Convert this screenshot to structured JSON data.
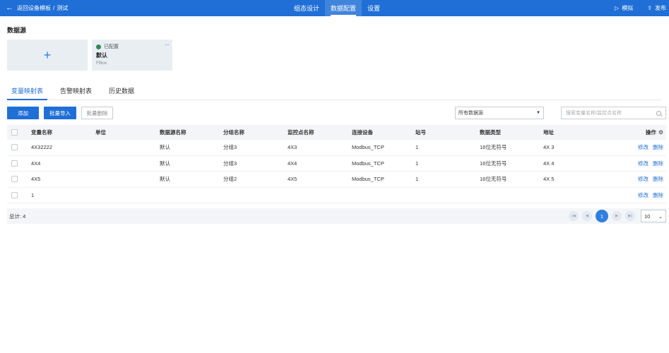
{
  "topbar": {
    "back_label": "返回设备模板",
    "separator": "/",
    "project": "测试",
    "tabs": [
      "组态设计",
      "数据配置",
      "设置"
    ],
    "active_tab": 1,
    "simulate": "模拟",
    "publish": "发布",
    "bg_color": "#1f6fd6"
  },
  "datasource": {
    "title": "数据源",
    "add_symbol": "+",
    "card": {
      "status": "已配置",
      "name": "默认",
      "type": "FBox",
      "more": "···"
    }
  },
  "subtabs": [
    "变量映射表",
    "告警映射表",
    "历史数据"
  ],
  "toolbar": {
    "add": "添加",
    "batch_import": "批量导入",
    "batch_delete": "批量删除",
    "filter_value": "所有数据源",
    "search_placeholder": "搜索变量名称/监控点名称"
  },
  "table": {
    "headers": [
      "变量名称",
      "单位",
      "数据源名称",
      "分组名称",
      "监控点名称",
      "连接设备",
      "站号",
      "数据类型",
      "地址",
      "操作"
    ],
    "rows": [
      [
        "4X32222",
        "",
        "默认",
        "分组3",
        "4X3",
        "Modbus_TCP",
        "1",
        "16位无符号",
        "4X 3"
      ],
      [
        "4X4",
        "",
        "默认",
        "分组3",
        "4X4",
        "Modbus_TCP",
        "1",
        "16位无符号",
        "4X 4"
      ],
      [
        "4X5",
        "",
        "默认",
        "分组2",
        "4X5",
        "Modbus_TCP",
        "1",
        "16位无符号",
        "4X 5"
      ],
      [
        "1",
        "",
        "",
        "",
        "",
        "",
        "",
        "",
        ""
      ]
    ],
    "edit": "修改",
    "delete": "删除"
  },
  "footer": {
    "total": "总计: 4",
    "current_page": "1",
    "page_size": "10"
  }
}
